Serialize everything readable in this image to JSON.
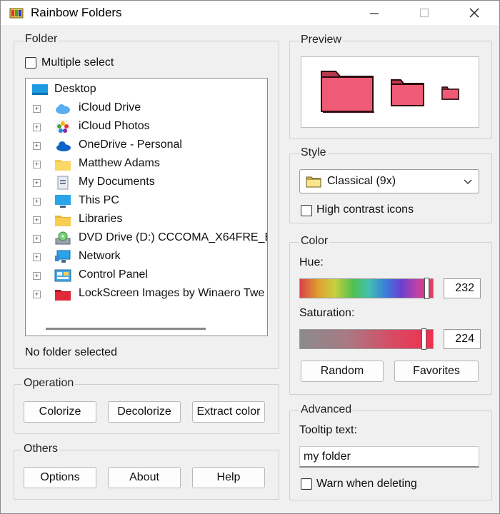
{
  "window": {
    "title": "Rainbow Folders"
  },
  "folder_group": {
    "label": "Folder",
    "multiple_select": "Multiple select",
    "tree": {
      "root": "Desktop",
      "items": [
        {
          "label": "iCloud Drive",
          "icon": "icloud-drive-icon"
        },
        {
          "label": "iCloud Photos",
          "icon": "icloud-photos-icon"
        },
        {
          "label": "OneDrive - Personal",
          "icon": "onedrive-icon"
        },
        {
          "label": "Matthew Adams",
          "icon": "user-folder-icon"
        },
        {
          "label": "My Documents",
          "icon": "documents-icon"
        },
        {
          "label": "This PC",
          "icon": "pc-icon"
        },
        {
          "label": "Libraries",
          "icon": "libraries-icon"
        },
        {
          "label": "DVD Drive (D:) CCCOMA_X64FRE_E",
          "icon": "dvd-drive-icon"
        },
        {
          "label": "Network",
          "icon": "network-icon"
        },
        {
          "label": "Control Panel",
          "icon": "control-panel-icon"
        },
        {
          "label": "LockScreen Images by Winaero Twe",
          "icon": "red-folder-icon"
        }
      ]
    },
    "status": "No folder selected"
  },
  "operation_group": {
    "label": "Operation",
    "colorize": "Colorize",
    "decolorize": "Decolorize",
    "extract_color": "Extract color"
  },
  "others_group": {
    "label": "Others",
    "options": "Options",
    "about": "About",
    "help": "Help"
  },
  "preview_group": {
    "label": "Preview",
    "folder_color": "#ee5a74"
  },
  "style_group": {
    "label": "Style",
    "selected": "Classical (9x)",
    "high_contrast": "High contrast icons"
  },
  "color_group": {
    "label": "Color",
    "hue_label": "Hue:",
    "hue_value": "232",
    "saturation_label": "Saturation:",
    "saturation_value": "224",
    "random": "Random",
    "favorites": "Favorites"
  },
  "advanced_group": {
    "label": "Advanced",
    "tooltip_label": "Tooltip text:",
    "tooltip_value": "my folder",
    "warn_delete": "Warn when deleting"
  }
}
